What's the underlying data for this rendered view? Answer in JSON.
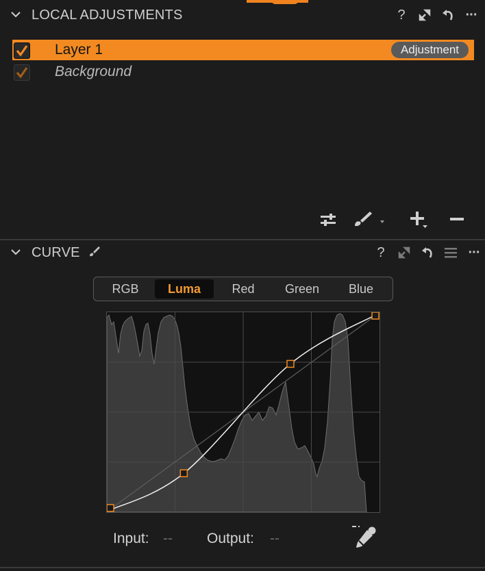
{
  "local_adjustments": {
    "title": "LOCAL ADJUSTMENTS",
    "header_icons": [
      "help-icon",
      "expand-icon",
      "reset-icon",
      "more-icon"
    ],
    "help_label": "?",
    "more_label": "···",
    "layers": [
      {
        "name": "Layer 1",
        "checked": true,
        "selected": true,
        "badge": "Adjustment"
      },
      {
        "name": "Background",
        "checked": true,
        "selected": false
      }
    ],
    "tools": [
      "sliders-icon",
      "brush-icon",
      "add-layer-icon",
      "remove-layer-icon"
    ]
  },
  "curve": {
    "title": "CURVE",
    "header_icons": [
      "help-icon",
      "expand-icon",
      "reset-icon",
      "presets-icon",
      "more-icon"
    ],
    "help_label": "?",
    "more_label": "···",
    "tabs": [
      {
        "label": "RGB",
        "active": false
      },
      {
        "label": "Luma",
        "active": true
      },
      {
        "label": "Red",
        "active": false
      },
      {
        "label": "Green",
        "active": false
      },
      {
        "label": "Blue",
        "active": false
      }
    ],
    "input_label": "Input:",
    "input_value": "--",
    "output_label": "Output:",
    "output_value": "--",
    "control_points": [
      {
        "input": 0,
        "output": 0
      },
      {
        "input": 0.28,
        "output": 0.19
      },
      {
        "input": 0.675,
        "output": 0.745
      },
      {
        "input": 1,
        "output": 1
      }
    ]
  },
  "colors": {
    "accent": "#f28a21",
    "panel_bg": "#1c1c1c",
    "histogram": "#3b3b3b"
  }
}
